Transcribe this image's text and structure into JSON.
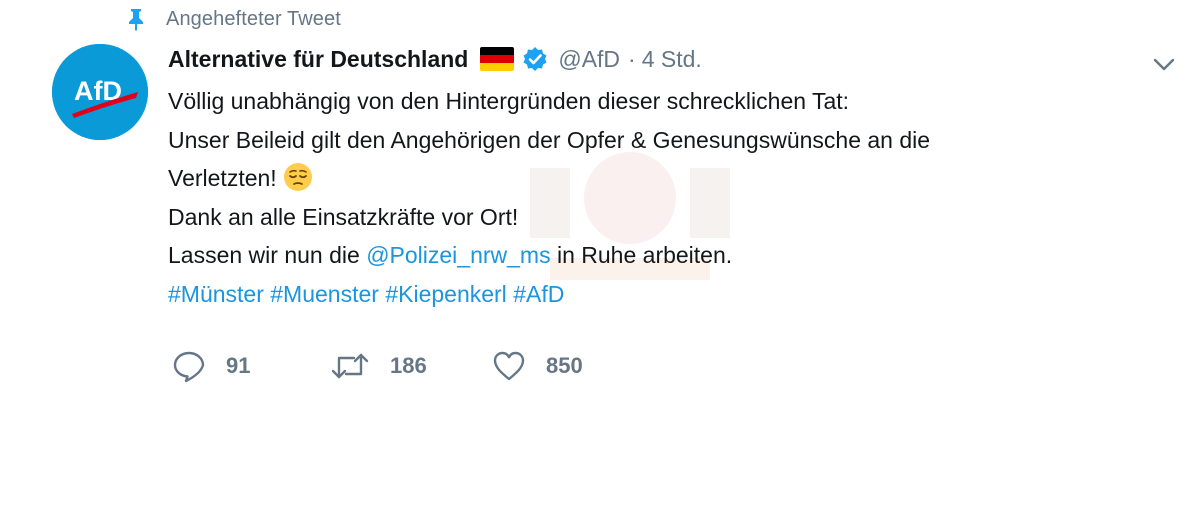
{
  "pinned": {
    "label": "Angehefteter Tweet",
    "icon": "pin-icon"
  },
  "author": {
    "avatar_text": "AfD",
    "name": "Alternative für Deutschland",
    "flag_icon": "germany-flag-icon",
    "verified_icon": "verified-badge-icon",
    "handle": "@AfD",
    "separator": "·",
    "time": "4 Std."
  },
  "menu": {
    "icon": "chevron-down-icon"
  },
  "tweet": {
    "line1": "Völlig unabhängig von den Hintergründen dieser schrecklichen Tat:",
    "line2": "Unser Beileid gilt den Angehörigen der Opfer & Genesungswünsche an die",
    "line3": "Verletzten!",
    "line3_emoji": "pensive-face-emoji",
    "line4": "Dank an alle Einsatzkräfte vor Ort!",
    "line5_before": "Lassen wir nun die ",
    "line5_mention": "@Polizei_nrw_ms",
    "line5_after": " in Ruhe arbeiten.",
    "hashtags": [
      "#Münster",
      "#Muenster",
      "#Kiepenkerl",
      "#AfD"
    ]
  },
  "actions": {
    "reply": {
      "icon": "reply-icon",
      "count": "91"
    },
    "retweet": {
      "icon": "retweet-icon",
      "count": "186"
    },
    "like": {
      "icon": "heart-icon",
      "count": "850"
    }
  },
  "colors": {
    "text": "#14171a",
    "secondary": "#657786",
    "link": "#1b95e0",
    "avatar_bg": "#0b9ad8",
    "verified": "#1da1f2"
  }
}
